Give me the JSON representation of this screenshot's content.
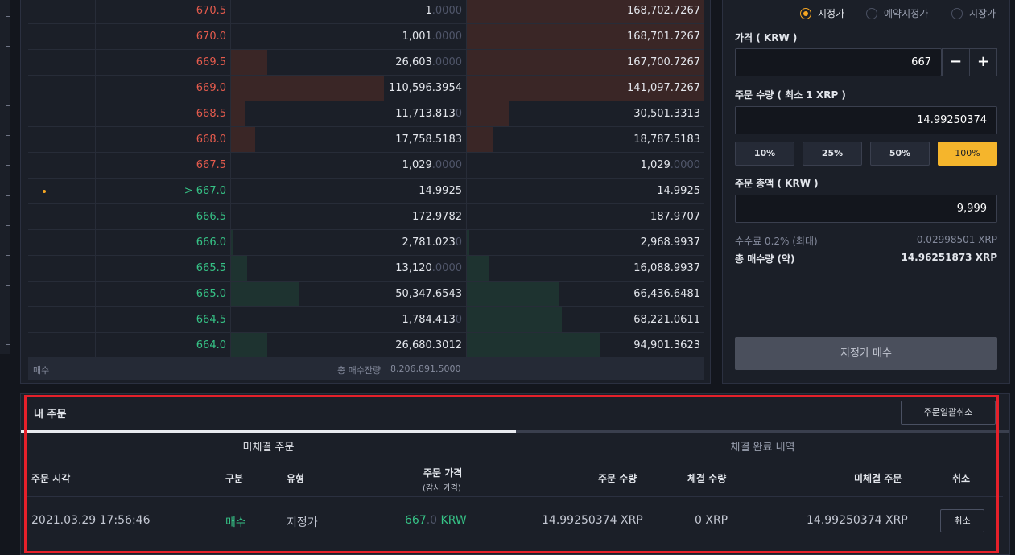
{
  "orderbook": {
    "rows": [
      {
        "side": "ask",
        "price": "670.5",
        "qty": "1",
        "qty_dim": ".0000",
        "cum": "168,702.7267",
        "cum_dim": ""
      },
      {
        "side": "ask",
        "price": "670.0",
        "qty": "1,001",
        "qty_dim": ".0000",
        "cum": "168,701.7267",
        "cum_dim": ""
      },
      {
        "side": "ask",
        "price": "669.5",
        "qty": "26,603",
        "qty_dim": ".0000",
        "cum": "167,700.7267",
        "cum_dim": ""
      },
      {
        "side": "ask",
        "price": "669.0",
        "qty": "110,596.3954",
        "qty_dim": "",
        "cum": "141,097.7267",
        "cum_dim": ""
      },
      {
        "side": "ask",
        "price": "668.5",
        "qty": "11,713.813",
        "qty_dim": "0",
        "cum": "30,501.3313",
        "cum_dim": ""
      },
      {
        "side": "ask",
        "price": "668.0",
        "qty": "17,758.5183",
        "qty_dim": "",
        "cum": "18,787.5183",
        "cum_dim": ""
      },
      {
        "side": "ask",
        "price": "667.5",
        "qty": "1,029",
        "qty_dim": ".0000",
        "cum": "1,029",
        "cum_dim": ".0000"
      },
      {
        "side": "bid",
        "price": "> 667.0",
        "qty": "14.9925",
        "qty_dim": "",
        "cum": "14.9925",
        "cum_dim": ""
      },
      {
        "side": "bid",
        "price": "666.5",
        "qty": "172.9782",
        "qty_dim": "",
        "cum": "187.9707",
        "cum_dim": ""
      },
      {
        "side": "bid",
        "price": "666.0",
        "qty": "2,781.023",
        "qty_dim": "0",
        "cum": "2,968.9937",
        "cum_dim": ""
      },
      {
        "side": "bid",
        "price": "665.5",
        "qty": "13,120",
        "qty_dim": ".0000",
        "cum": "16,088.9937",
        "cum_dim": ""
      },
      {
        "side": "bid",
        "price": "665.0",
        "qty": "50,347.6543",
        "qty_dim": "",
        "cum": "66,436.6481",
        "cum_dim": ""
      },
      {
        "side": "bid",
        "price": "664.5",
        "qty": "1,784.413",
        "qty_dim": "0",
        "cum": "68,221.0611",
        "cum_dim": ""
      },
      {
        "side": "bid",
        "price": "664.0",
        "qty": "26,680.3012",
        "qty_dim": "",
        "cum": "94,901.3623",
        "cum_dim": ""
      }
    ],
    "footer": {
      "label": "매수",
      "total_label": "총 매수잔량",
      "total_value": "8,206,891.5000"
    }
  },
  "form": {
    "order_types": [
      "지정가",
      "예약지정가",
      "시장가"
    ],
    "price_label": "가격 ( KRW )",
    "price_value": "667",
    "minus": "−",
    "plus": "+",
    "qty_label": "주문 수량 ( 최소 1 XRP )",
    "qty_value": "14.99250374",
    "percents": [
      "10%",
      "25%",
      "50%",
      "100%"
    ],
    "total_label": "주문 총액 ( KRW )",
    "total_value": "9,999",
    "fee_label": "수수료 0.2% (최대)",
    "fee_value": "0.02998501 XRP",
    "buy_qty_label": "총 매수량 (약)",
    "buy_qty_value": "14.96251873 XRP",
    "submit": "지정가 매수"
  },
  "my_orders": {
    "title": "내 주문",
    "cancel_all": "주문일괄취소",
    "tabs": [
      "미체결 주문",
      "체결 완료 내역"
    ],
    "headers": {
      "time": "주문 시각",
      "side": "구분",
      "type": "유형",
      "price": "주문 가격",
      "price_sub": "(감시 가격)",
      "qty": "주문 수량",
      "filled": "체결 수량",
      "unfilled": "미체결 주문",
      "cancel": "취소"
    },
    "row": {
      "time": "2021.03.29 17:56:46",
      "side": "매수",
      "type": "지정가",
      "price": "667",
      "price_dim": ".0",
      "price_unit": "KRW",
      "qty": "14.99250374 XRP",
      "filled": "0 XRP",
      "unfilled": "14.99250374 XRP",
      "cancel": "취소"
    }
  }
}
